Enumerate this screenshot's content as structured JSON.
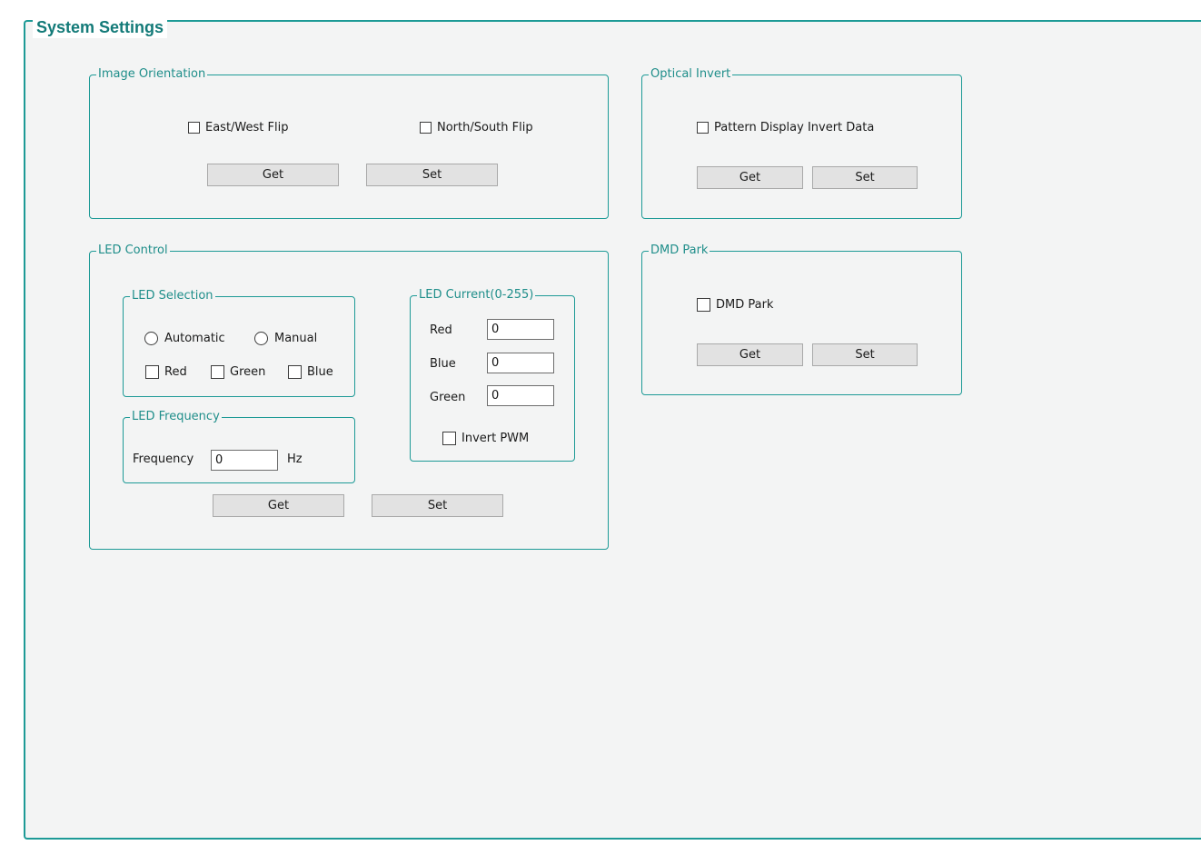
{
  "title": "System Settings",
  "image_orientation": {
    "title": "Image Orientation",
    "east_west_flip": "East/West Flip",
    "north_south_flip": "North/South Flip",
    "get_label": "Get",
    "set_label": "Set"
  },
  "optical_invert": {
    "title": "Optical Invert",
    "pattern_display_invert": "Pattern Display Invert Data",
    "get_label": "Get",
    "set_label": "Set"
  },
  "led_control": {
    "title": "LED Control",
    "led_selection": {
      "title": "LED Selection",
      "automatic": "Automatic",
      "manual": "Manual",
      "red": "Red",
      "green": "Green",
      "blue": "Blue"
    },
    "led_current": {
      "title": "LED Current(0-255)",
      "red_label": "Red",
      "red_value": "0",
      "blue_label": "Blue",
      "blue_value": "0",
      "green_label": "Green",
      "green_value": "0",
      "invert_pwm": "Invert PWM"
    },
    "led_frequency": {
      "title": "LED Frequency",
      "frequency_label": "Frequency",
      "frequency_value": "0",
      "unit": "Hz"
    },
    "get_label": "Get",
    "set_label": "Set"
  },
  "dmd_park": {
    "title": "DMD Park",
    "dmd_park_label": "DMD Park",
    "get_label": "Get",
    "set_label": "Set"
  },
  "colors": {
    "accent": "#1d9a96",
    "title": "#137a78",
    "button_bg": "#e2e2e2",
    "panel_bg": "#f3f4f4"
  }
}
